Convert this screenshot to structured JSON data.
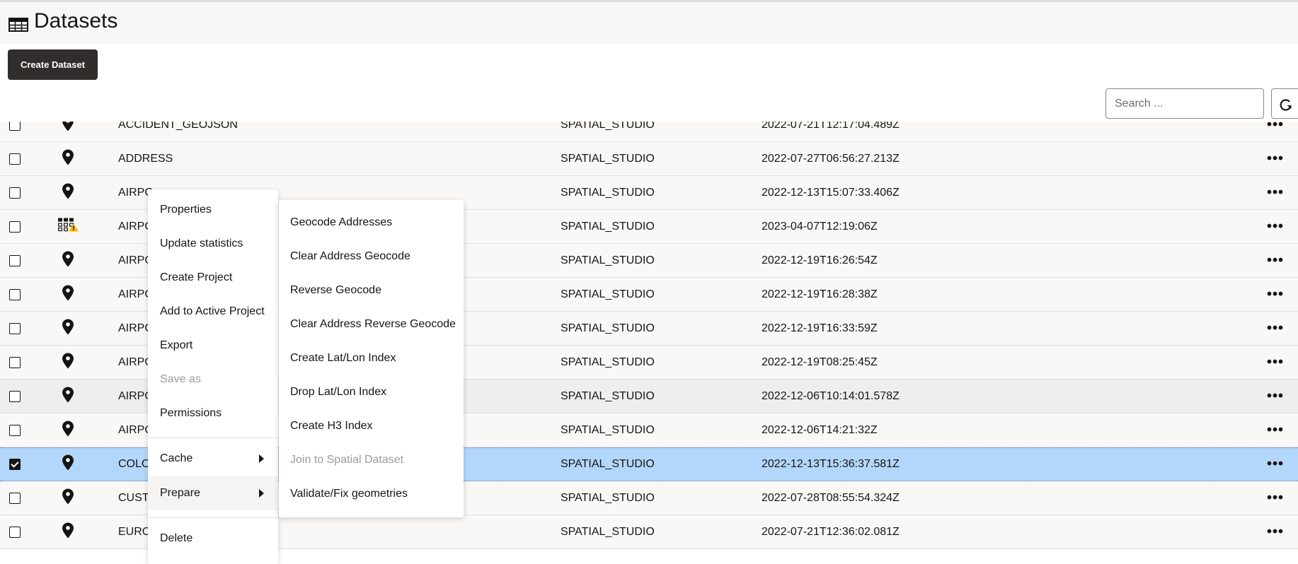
{
  "header": {
    "title": "Datasets",
    "icon": "table-icon"
  },
  "toolbar": {
    "create_label": "Create Dataset",
    "search_placeholder": "Search ...",
    "refresh_icon": "refresh-icon"
  },
  "colors": {
    "button_bg": "#312d2a",
    "selected_row": "#b3d7fb",
    "row_bg": "#f9f8f6"
  },
  "rows": [
    {
      "name": "ACCIDENT_GEOJSON",
      "owner": "SPATIAL_STUDIO",
      "date": "2022-07-21T12:17:04.489Z",
      "icon": "map-pin",
      "checked": false
    },
    {
      "name": "ADDRESS",
      "owner": "SPATIAL_STUDIO",
      "date": "2022-07-27T06:56:27.213Z",
      "icon": "map-pin",
      "checked": false
    },
    {
      "name": "AIRPO",
      "owner": "SPATIAL_STUDIO",
      "date": "2022-12-13T15:07:33.406Z",
      "icon": "map-pin",
      "checked": false
    },
    {
      "name": "AIRPO",
      "owner": "SPATIAL_STUDIO",
      "date": "2023-04-07T12:19:06Z",
      "icon": "grid-warning",
      "checked": false
    },
    {
      "name": "AIRPO",
      "owner": "SPATIAL_STUDIO",
      "date": "2022-12-19T16:26:54Z",
      "icon": "map-pin",
      "checked": false
    },
    {
      "name": "AIRPO",
      "owner": "SPATIAL_STUDIO",
      "date": "2022-12-19T16:28:38Z",
      "icon": "map-pin",
      "checked": false
    },
    {
      "name": "AIRPO",
      "owner": "SPATIAL_STUDIO",
      "date": "2022-12-19T16:33:59Z",
      "icon": "map-pin",
      "checked": false
    },
    {
      "name": "AIRPO",
      "owner": "SPATIAL_STUDIO",
      "date": "2022-12-19T08:25:45Z",
      "icon": "map-pin",
      "checked": false
    },
    {
      "name": "AIRPO",
      "owner": "SPATIAL_STUDIO",
      "date": "2022-12-06T10:14:01.578Z",
      "icon": "map-pin",
      "checked": false,
      "hover": true
    },
    {
      "name": "AIRPO",
      "owner": "SPATIAL_STUDIO",
      "date": "2022-12-06T14:21:32Z",
      "icon": "map-pin",
      "checked": false
    },
    {
      "name": "COLO",
      "owner": "SPATIAL_STUDIO",
      "date": "2022-12-13T15:36:37.581Z",
      "icon": "map-pin",
      "checked": true,
      "selected": true
    },
    {
      "name": "CUSTO",
      "owner": "SPATIAL_STUDIO",
      "date": "2022-07-28T08:55:54.324Z",
      "icon": "map-pin",
      "checked": false
    },
    {
      "name": "EURO",
      "owner": "SPATIAL_STUDIO",
      "date": "2022-07-21T12:36:02.081Z",
      "icon": "map-pin",
      "checked": false
    }
  ],
  "context_menu": {
    "items": [
      "Properties",
      "Update statistics",
      "Create Project",
      "Add to Active Project",
      "Export",
      "Save as",
      "Permissions"
    ],
    "disabled": [
      "Save as"
    ],
    "cache": "Cache",
    "prepare": "Prepare",
    "delete": "Delete"
  },
  "submenu": {
    "items": [
      "Geocode Addresses",
      "Clear Address Geocode",
      "Reverse Geocode",
      "Clear Address Reverse Geocode",
      "Create Lat/Lon Index",
      "Drop Lat/Lon Index",
      "Create H3 Index",
      "Join to Spatial Dataset",
      "Validate/Fix geometries"
    ],
    "disabled": [
      "Join to Spatial Dataset"
    ]
  }
}
